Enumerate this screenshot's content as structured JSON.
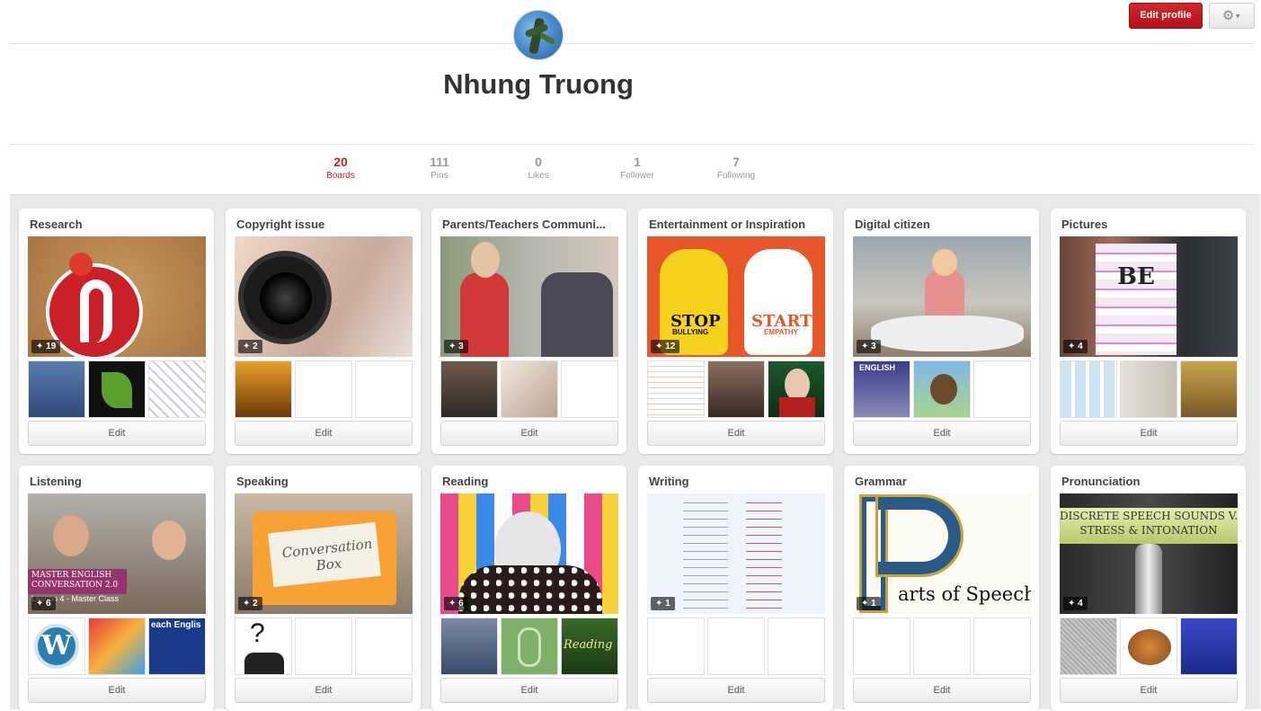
{
  "header": {
    "profile_name": "Nhung Truong",
    "edit_profile_label": "Edit profile",
    "settings_icon": "gear-icon",
    "accent_color": "#c8232c"
  },
  "stats": [
    {
      "value": "20",
      "label": "Boards",
      "active": true
    },
    {
      "value": "111",
      "label": "Pins",
      "active": false
    },
    {
      "value": "0",
      "label": "Likes",
      "active": false
    },
    {
      "value": "1",
      "label": "Follower",
      "active": false
    },
    {
      "value": "7",
      "label": "Following",
      "active": false
    }
  ],
  "boards": [
    {
      "title": "Research",
      "pins": "19",
      "edit_label": "Edit"
    },
    {
      "title": "Copyright issue",
      "pins": "2",
      "edit_label": "Edit"
    },
    {
      "title": "Parents/Teachers Communi...",
      "pins": "3",
      "edit_label": "Edit"
    },
    {
      "title": "Entertainment or Inspiration",
      "pins": "12",
      "edit_label": "Edit",
      "cover_text_left": "STOP",
      "cover_sub_left": "BULLYING",
      "cover_text_right": "START",
      "cover_sub_right": "EMPATHY"
    },
    {
      "title": "Digital citizen",
      "pins": "3",
      "edit_label": "Edit",
      "thumb_text": "ENGLISH"
    },
    {
      "title": "Pictures",
      "pins": "4",
      "edit_label": "Edit",
      "cover_text": "BE"
    },
    {
      "title": "Listening",
      "pins": "6",
      "edit_label": "Edit",
      "cover_text": "MASTER ENGLISH CONVERSATION 2.0",
      "cover_sub": "Lesson 4 - Master Class",
      "thumb_text": "each Englis"
    },
    {
      "title": "Speaking",
      "pins": "2",
      "edit_label": "Edit",
      "cover_text": "Conversation Box",
      "thumb_text": "?"
    },
    {
      "title": "Reading",
      "pins": "6",
      "edit_label": "Edit",
      "thumb_text": "Reading"
    },
    {
      "title": "Writing",
      "pins": "1",
      "edit_label": "Edit"
    },
    {
      "title": "Grammar",
      "pins": "1",
      "edit_label": "Edit",
      "cover_text": "arts of Speech"
    },
    {
      "title": "Pronunciation",
      "pins": "4",
      "edit_label": "Edit",
      "cover_text": "DISCRETE SPEECH SOUNDS V.",
      "cover_sub": "STRESS & INTONATION"
    }
  ]
}
